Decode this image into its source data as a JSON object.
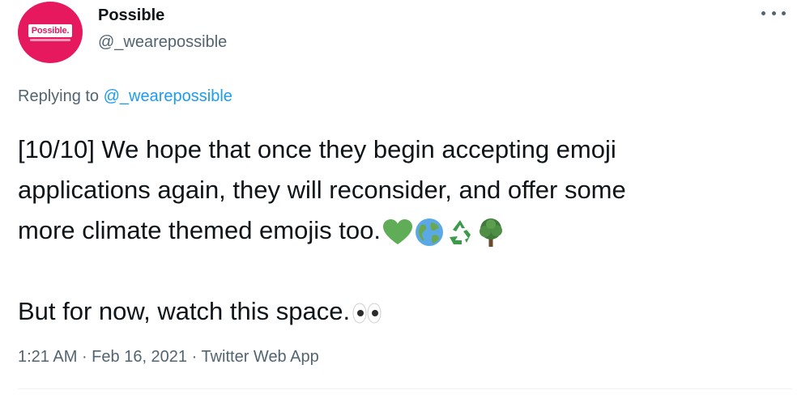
{
  "author": {
    "display_name": "Possible",
    "handle": "@_wearepossible",
    "avatar_text": "Possible."
  },
  "reply": {
    "prefix": "Replying to ",
    "handle": "@_wearepossible"
  },
  "tweet": {
    "line1": "[10/10] We hope that once they begin accepting emoji",
    "line2": "applications again, they will reconsider, and offer some",
    "line3": "more climate themed emojis too.",
    "line5": "But for now, watch this space.",
    "emojis": [
      "green-heart-icon",
      "globe-icon",
      "recycle-icon",
      "tree-icon",
      "eyes-icon"
    ]
  },
  "meta": {
    "time": "1:21 AM",
    "separator1": " · ",
    "date": "Feb 16, 2021",
    "separator2": " · ",
    "source": "Twitter Web App"
  },
  "colors": {
    "avatar_bg": "#e6195f",
    "link": "#1d9bf0",
    "secondary_text": "#536471"
  }
}
